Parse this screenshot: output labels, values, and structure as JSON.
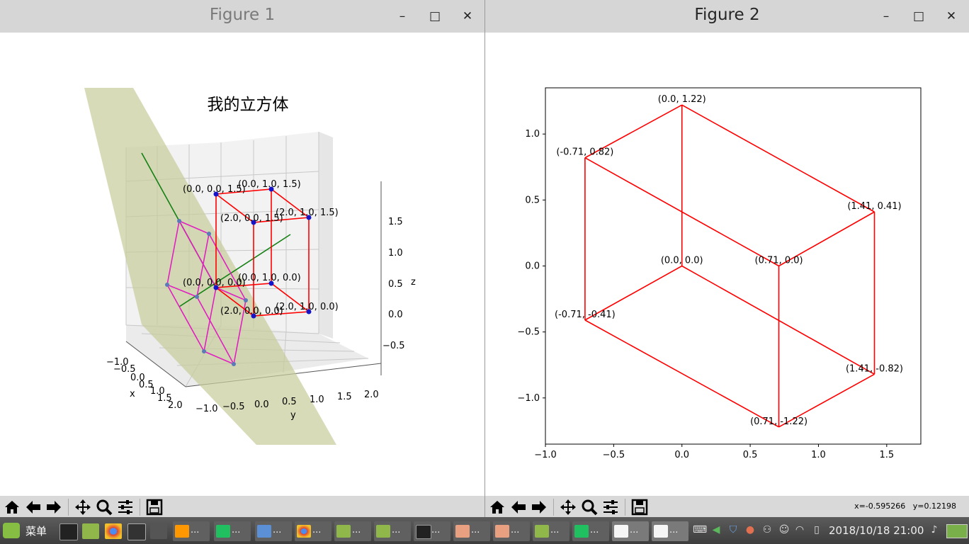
{
  "windows": [
    {
      "title": "Figure 1",
      "min_label": "–",
      "max_label": "□",
      "close_label": "✕"
    },
    {
      "title": "Figure 2",
      "min_label": "–",
      "max_label": "□",
      "close_label": "✕"
    }
  ],
  "toolbar_icons": [
    "home-icon",
    "back-icon",
    "forward-icon",
    "pan-icon",
    "zoom-icon",
    "configure-icon",
    "save-icon"
  ],
  "status": {
    "x": "x=-0.595266",
    "y": "y=0.12198"
  },
  "chart_data": [
    {
      "type": "3d-line",
      "title": "我的立方体",
      "xlabel": "x",
      "ylabel": "y",
      "zlabel": "z",
      "x_ticks": [
        "−1.0",
        "−0.5",
        "0.0",
        "0.5",
        "1.0",
        "1.5",
        "2.0"
      ],
      "y_ticks": [
        "−1.0",
        "−0.5",
        "0.0",
        "0.5",
        "1.0",
        "1.5",
        "2.0"
      ],
      "z_ticks": [
        "1.5",
        "1.0",
        "0.5",
        "0.0",
        "−0.5"
      ],
      "point_labels": [
        "(0.0, 0.0, 1.5)",
        "(0.0, 1.0, 1.5)",
        "(2.0, 0.0, 1.5)",
        "(2.0, 1.0, 1.5)",
        "(0.0, 0.0, 0.0)",
        "(0.0, 1.0, 0.0)",
        "(2.0, 0.0, 0.0)",
        "(2.0, 1.0, 0.0)"
      ],
      "colors": {
        "cube": "#ff0000",
        "points": "#1414c8",
        "plane": "#c8cc9a",
        "axis_line": "#138013",
        "projection": "#e020c0"
      }
    },
    {
      "type": "line",
      "xlim": [
        -1.0,
        1.75
      ],
      "ylim": [
        -1.35,
        1.35
      ],
      "x_ticks": [
        "−1.0",
        "−0.5",
        "0.0",
        "0.5",
        "1.0",
        "1.5"
      ],
      "x_tick_values": [
        -1.0,
        -0.5,
        0.0,
        0.5,
        1.0,
        1.5
      ],
      "y_ticks": [
        "1.0",
        "0.5",
        "0.0",
        "−0.5",
        "−1.0"
      ],
      "y_tick_values": [
        1.0,
        0.5,
        0.0,
        -0.5,
        -1.0
      ],
      "points": [
        {
          "x": 0.0,
          "y": 1.22,
          "label": "(0.0, 1.22)"
        },
        {
          "x": -0.71,
          "y": 0.82,
          "label": "(-0.71, 0.82)"
        },
        {
          "x": 1.41,
          "y": 0.41,
          "label": "(1.41, 0.41)"
        },
        {
          "x": 0.0,
          "y": 0.0,
          "label": "(0.0, 0.0)"
        },
        {
          "x": 0.71,
          "y": 0.0,
          "label": "(0.71, 0.0)"
        },
        {
          "x": -0.71,
          "y": -0.41,
          "label": "(-0.71, -0.41)"
        },
        {
          "x": 1.41,
          "y": -0.82,
          "label": "(1.41, -0.82)"
        },
        {
          "x": 0.71,
          "y": -1.22,
          "label": "(0.71, -1.22)"
        }
      ],
      "edges": [
        [
          0,
          1
        ],
        [
          0,
          3
        ],
        [
          0,
          2
        ],
        [
          1,
          5
        ],
        [
          1,
          4
        ],
        [
          2,
          4
        ],
        [
          2,
          6
        ],
        [
          3,
          5
        ],
        [
          3,
          6
        ],
        [
          4,
          7
        ],
        [
          5,
          7
        ],
        [
          6,
          7
        ]
      ],
      "line_color": "#ff0000"
    }
  ],
  "taskbar": {
    "menu_label": "菜单",
    "task_suffix": "...",
    "clock": "2018/10/18  21:00"
  }
}
